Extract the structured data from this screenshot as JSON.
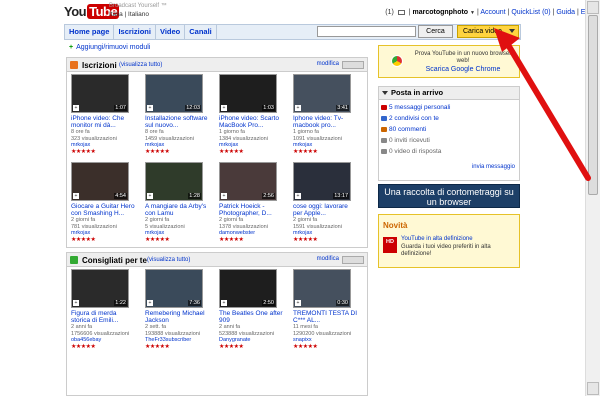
{
  "header": {
    "logo_you": "You",
    "logo_tube": "Tube",
    "tagline": "Broadcast Yourself ™",
    "locale": "Italia | Italiano",
    "mail_count": "(1)",
    "username": "marcotognphoto",
    "links": [
      "Account",
      "QuickList (0)",
      "Guida",
      "Esci"
    ]
  },
  "nav": {
    "tabs": [
      "Home page",
      "Iscrizioni",
      "Video",
      "Canali"
    ],
    "search_button": "Cerca",
    "upload_button": "Carica video"
  },
  "add_modules": "Aggiungi/rimuovi moduli",
  "subscriptions": {
    "title": "Iscrizioni",
    "view_all": "(visualizza tutto)",
    "edit": "modifica",
    "videos": [
      {
        "title": "iPhone video: Che monitor mi dà...",
        "age": "8 ore fa",
        "views": "323 visualizzazioni",
        "user": "mrkojax",
        "duration": "1:07"
      },
      {
        "title": "Installazione software sul nuovo...",
        "age": "8 ore fa",
        "views": "1459 visualizzazioni",
        "user": "mrkojax",
        "duration": "12:03"
      },
      {
        "title": "iPhone video: Scarto MacBook Pro...",
        "age": "1 giorno fa",
        "views": "1384 visualizzazioni",
        "user": "mrkojax",
        "duration": "1:03"
      },
      {
        "title": "Iphone video: Tv-macbook pro...",
        "age": "1 giorno fa",
        "views": "1091 visualizzazioni",
        "user": "mrkojax",
        "duration": "3:41"
      },
      {
        "title": "Giocare a Guitar Hero con Smashing H...",
        "age": "2 giorni fa",
        "views": "781 visualizzazioni",
        "user": "mrkojax",
        "duration": "4:54"
      },
      {
        "title": "A mangiare da Arby's con Lamu",
        "age": "2 giorni fa",
        "views": "5 visualizzazioni",
        "user": "mrkojax",
        "duration": "1:28"
      },
      {
        "title": "Patrick Hoeick - Photographer, D...",
        "age": "2 giorni fa",
        "views": "1378 visualizzazioni",
        "user": "damonwebster",
        "duration": "2:56"
      },
      {
        "title": "cose oggi: lavorare per Apple...",
        "age": "2 giorni fa",
        "views": "1591 visualizzazioni",
        "user": "mrkojax",
        "duration": "13:17"
      }
    ]
  },
  "recommended": {
    "title": "Consigliati per te",
    "view_all": "(visualizza tutto)",
    "edit": "modifica",
    "videos": [
      {
        "title": "Figura di merda storica di Emili...",
        "age": "2 anni fa",
        "views": "1756606 visualizzazioni",
        "user": "oba456ebay",
        "duration": "1:22"
      },
      {
        "title": "Remebering Michael Jackson",
        "age": "2 sett. fa",
        "views": "193888 visualizzazioni",
        "user": "TheFr33subscriber",
        "duration": "7:36"
      },
      {
        "title": "The Beatles One after 909",
        "age": "2 anni fa",
        "views": "523888 visualizzazioni",
        "user": "Danygranate",
        "duration": "2:50"
      },
      {
        "title": "TREMONTI TESTA DI C*** AL...",
        "age": "11 mesi fa",
        "views": "1290200 visualizzazioni",
        "user": "snapixx",
        "duration": "0:30"
      }
    ]
  },
  "chrome_promo": {
    "text": "Prova YouTube in un nuovo browser web!",
    "link": "Scarica Google Chrome"
  },
  "inbox": {
    "title": "Posta in arrivo",
    "items": [
      {
        "label": "5 messaggi personali",
        "color": "#c00"
      },
      {
        "label": "2 condivisi con te",
        "color": "#36c"
      },
      {
        "label": "80 commenti",
        "color": "#c60"
      },
      {
        "label": "0 inviti ricevuti",
        "color": "#888"
      },
      {
        "label": "0 video di risposta",
        "color": "#888"
      }
    ],
    "send": "invia messaggio"
  },
  "shorts_banner": "Una raccolta di cortometraggi su un browser",
  "novita": {
    "title": "Novità",
    "badge": "HD",
    "link": "YouTube in alta definizione",
    "desc": "Guarda i tuoi video preferiti in alta definizione!"
  },
  "colors": {
    "accent": "#cc0000",
    "link": "#0033cc",
    "upload": "#ffd440"
  }
}
